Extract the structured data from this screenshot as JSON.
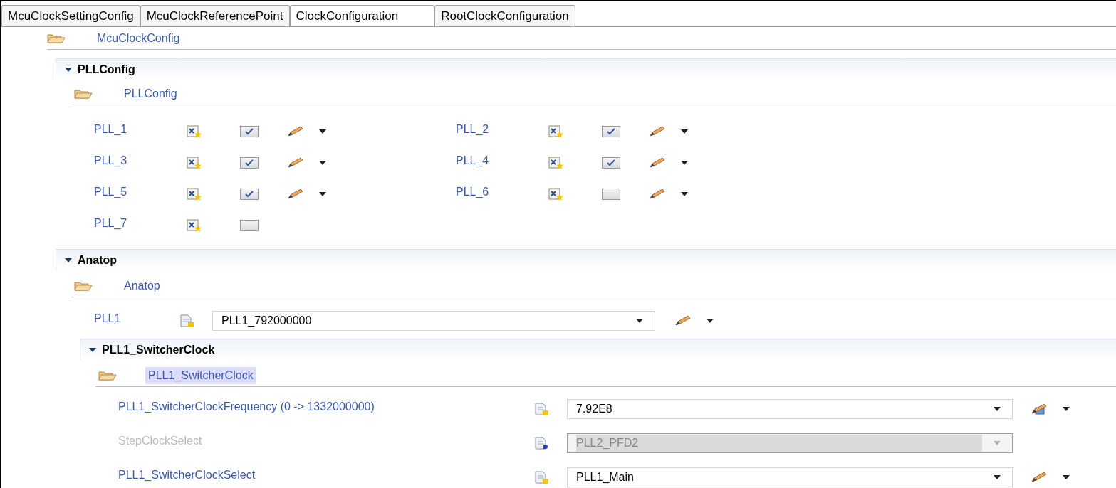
{
  "tabs": [
    {
      "label": "McuClockSettingConfig",
      "selected": false
    },
    {
      "label": "McuClockReferencePoint",
      "selected": false
    },
    {
      "label": "ClockConfiguration",
      "selected": true
    },
    {
      "label": "RootClockConfiguration",
      "selected": false
    }
  ],
  "root_folder": "McuClockConfig",
  "pll_config": {
    "title": "PLLConfig",
    "expanded": true,
    "folder": "PLLConfig",
    "items": [
      {
        "name": "PLL_1",
        "checked": true,
        "editable": true
      },
      {
        "name": "PLL_2",
        "checked": true,
        "editable": true
      },
      {
        "name": "PLL_3",
        "checked": true,
        "editable": true
      },
      {
        "name": "PLL_4",
        "checked": true,
        "editable": true
      },
      {
        "name": "PLL_5",
        "checked": true,
        "editable": true
      },
      {
        "name": "PLL_6",
        "checked": false,
        "editable": true
      },
      {
        "name": "PLL_7",
        "checked": false,
        "editable": false
      }
    ]
  },
  "anatop": {
    "title": "Anatop",
    "expanded": true,
    "folder": "Anatop",
    "pll1": {
      "label": "PLL1",
      "value": "PLL1_792000000"
    },
    "switcher": {
      "title": "PLL1_SwitcherClock",
      "expanded": true,
      "folder": "PLL1_SwitcherClock",
      "folder_selected": true,
      "fields": [
        {
          "kind": "number",
          "label": "PLL1_SwitcherClockFrequency (0 -> 1332000000)",
          "value": "7.92E8",
          "disabled": false
        },
        {
          "kind": "enum",
          "label": "StepClockSelect",
          "value": "PLL2_PFD2",
          "disabled": true
        },
        {
          "kind": "enum",
          "label": "PLL1_SwitcherClockSelect",
          "value": "PLL1_Main",
          "disabled": false
        }
      ]
    }
  }
}
